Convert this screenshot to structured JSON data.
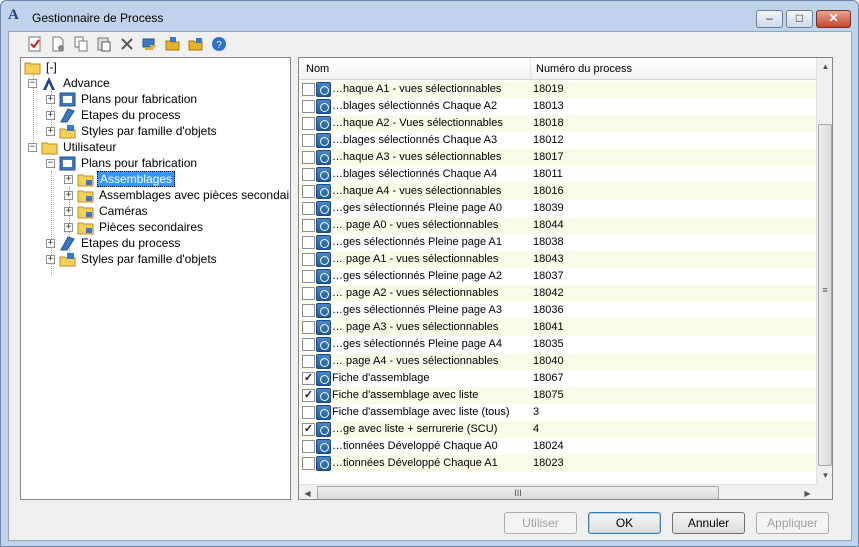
{
  "window": {
    "title": "Gestionnaire de Process"
  },
  "toolbar": {
    "items": [
      "check-icon",
      "new-doc-icon",
      "copy-icon",
      "paste-icon",
      "delete-icon",
      "import-icon",
      "export-icon",
      "export-folder-icon",
      "help-icon"
    ]
  },
  "tree": {
    "root": "[-]",
    "advance": {
      "label": "Advance",
      "children": [
        "Plans pour fabrication",
        "Etapes du process",
        "Styles par famille d'objets"
      ]
    },
    "utilisateur": {
      "label": "Utilisateur",
      "plans": {
        "label": "Plans pour fabrication",
        "children": [
          "Assemblages",
          "Assemblages avec pièces secondaires",
          "Caméras",
          "Pièces secondaires"
        ]
      },
      "etapes": "Etapes du process",
      "styles": "Styles par famille d'objets"
    }
  },
  "grid": {
    "columns": [
      "Nom",
      "Numéro du process"
    ],
    "rows": [
      {
        "name": "…haque A1 - vues sélectionnables",
        "number": "18019",
        "checked": false
      },
      {
        "name": "…blages sélectionnés Chaque A2",
        "number": "18013",
        "checked": false
      },
      {
        "name": "…haque A2 - Vues sélectionnables",
        "number": "18018",
        "checked": false
      },
      {
        "name": "…blages sélectionnés Chaque A3",
        "number": "18012",
        "checked": false
      },
      {
        "name": "…haque A3 - vues sélectionnables",
        "number": "18017",
        "checked": false
      },
      {
        "name": "…blages sélectionnés Chaque A4",
        "number": "18011",
        "checked": false
      },
      {
        "name": "…haque A4 - vues sélectionnables",
        "number": "18016",
        "checked": false
      },
      {
        "name": "…ges sélectionnés Pleine page A0",
        "number": "18039",
        "checked": false
      },
      {
        "name": "… page A0 - vues sélectionnables",
        "number": "18044",
        "checked": false
      },
      {
        "name": "…ges sélectionnés Pleine page A1",
        "number": "18038",
        "checked": false
      },
      {
        "name": "… page A1 - vues sélectionnables",
        "number": "18043",
        "checked": false
      },
      {
        "name": "…ges sélectionnés Pleine page A2",
        "number": "18037",
        "checked": false
      },
      {
        "name": "… page A2  - vues sélectionnables",
        "number": "18042",
        "checked": false
      },
      {
        "name": "…ges sélectionnés Pleine page A3",
        "number": "18036",
        "checked": false
      },
      {
        "name": "… page A3 - vues sélectionnables",
        "number": "18041",
        "checked": false
      },
      {
        "name": "…ges sélectionnés Pleine page A4",
        "number": "18035",
        "checked": false
      },
      {
        "name": "… page A4 - vues sélectionnables",
        "number": "18040",
        "checked": false
      },
      {
        "name": "Fiche d'assemblage",
        "number": "18067",
        "checked": true
      },
      {
        "name": "Fiche d'assemblage avec liste",
        "number": "18075",
        "checked": true
      },
      {
        "name": "Fiche d'assemblage avec liste (tous)",
        "number": "3",
        "checked": false
      },
      {
        "name": "…ge avec liste + serrurerie (SCU)",
        "number": "4",
        "checked": true
      },
      {
        "name": "…tionnées Développé Chaque A0",
        "number": "18024",
        "checked": false
      },
      {
        "name": "…tionnées Développé Chaque A1",
        "number": "18023",
        "checked": false
      }
    ],
    "scroll_grip": "≡",
    "hscroll_grip": "III"
  },
  "buttons": {
    "use": "Utiliser",
    "ok": "OK",
    "cancel": "Annuler",
    "apply": "Appliquer"
  },
  "colors": {
    "selection": "#3399ff",
    "accent": "#1c5aa3",
    "row_alt": "#fbfbea"
  }
}
